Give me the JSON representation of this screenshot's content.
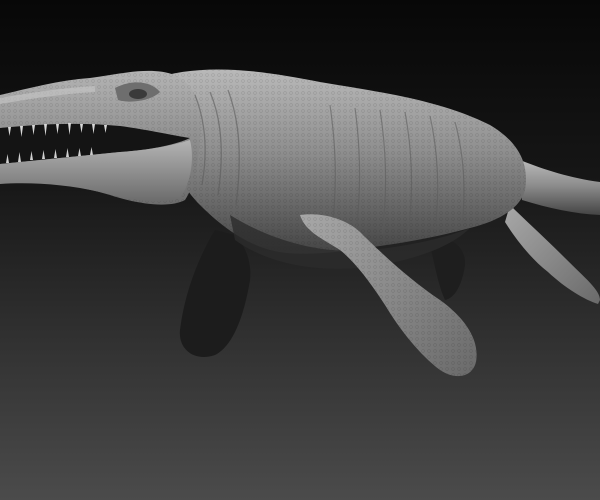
{
  "scene": {
    "subject": "pliosaur-sculpt",
    "background_top": "#0b0b0b",
    "background_bottom": "#4a4a4a",
    "body_color": "#8a8a8a",
    "body_highlight": "#bdbdbd",
    "body_shadow": "#3a3a3a",
    "teeth_color": "#d6d6d6",
    "mouth_color": "#1a1a1a"
  }
}
